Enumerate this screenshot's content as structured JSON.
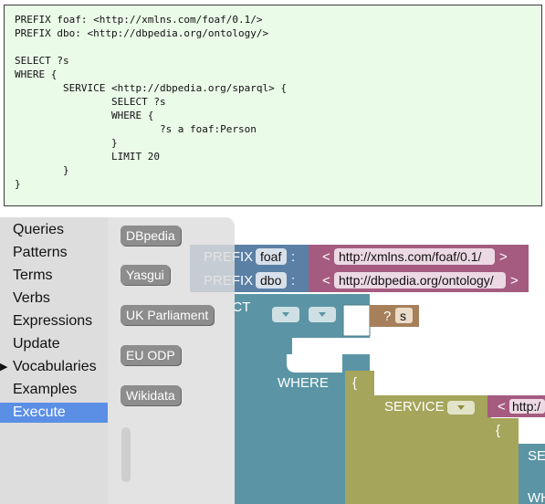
{
  "code": {
    "lines": [
      "PREFIX foaf: <http://xmlns.com/foaf/0.1/>",
      "PREFIX dbo: <http://dbpedia.org/ontology/>",
      "",
      "SELECT ?s",
      "WHERE {",
      "        SERVICE <http://dbpedia.org/sparql> {",
      "                SELECT ?s",
      "                WHERE {",
      "                        ?s a foaf:Person",
      "                }",
      "                LIMIT 20",
      "        }",
      "}"
    ]
  },
  "toolbox": {
    "categories": [
      {
        "label": "Queries"
      },
      {
        "label": "Patterns"
      },
      {
        "label": "Terms"
      },
      {
        "label": "Verbs"
      },
      {
        "label": "Expressions"
      },
      {
        "label": "Update"
      },
      {
        "label": "Vocabularies",
        "arrow": "▶"
      },
      {
        "label": "Examples"
      },
      {
        "label": "Execute",
        "selected": true
      }
    ]
  },
  "flyout": {
    "buttons": [
      "DBpedia",
      "Yasgui",
      "UK Parliament",
      "EU ODP",
      "Wikidata"
    ]
  },
  "blocks": {
    "prefix_label": "PREFIX",
    "colon": ":",
    "lt": "<",
    "gt": ">",
    "prefix1_name": "foaf",
    "prefix1_iri": "http://xmlns.com/foaf/0.1/",
    "prefix2_name": "dbo",
    "prefix2_iri": "http://dbpedia.org/ontology/",
    "select_label": "SELECT",
    "where_label": "WHERE",
    "open_brace": "{",
    "service_label": "SERVICE",
    "service_iri_partial": "http:/",
    "var_q": "?",
    "var_s": "s",
    "inner_select_partial": "SE",
    "inner_where_partial": "WH"
  },
  "colors": {
    "prefix_block": "#5b80a5",
    "iri_block": "#a55b80",
    "select_block": "#5b95a5",
    "where_block": "#a5a55b",
    "var_block": "#a5805b",
    "selected_category": "#5b8fe6"
  }
}
